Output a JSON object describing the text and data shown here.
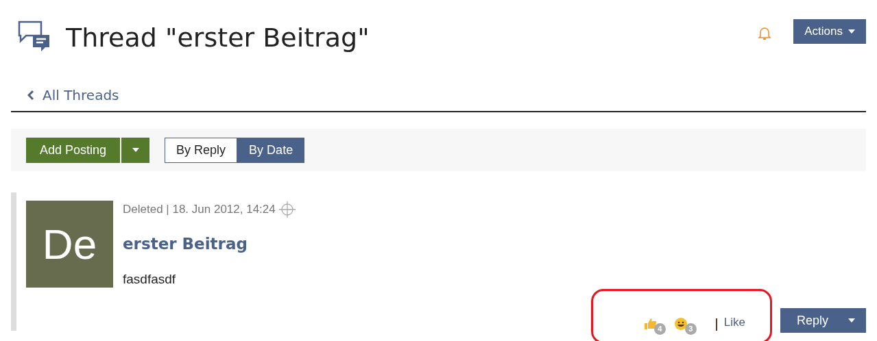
{
  "header": {
    "title": "Thread \"erster Beitrag\"",
    "actions_button": "Actions"
  },
  "back_link": "All Threads",
  "toolbar": {
    "add_button": "Add Posting",
    "sort_options": [
      {
        "label": "By Reply",
        "selected": false
      },
      {
        "label": "By Date",
        "selected": true
      }
    ]
  },
  "posting": {
    "avatar_initials": "De",
    "meta": "Deleted | 18. Jun 2012, 14:24",
    "title": "erster Beitrag",
    "body": "fasdfasdf",
    "reactions": [
      {
        "kind": "thumbs",
        "count": "4"
      },
      {
        "kind": "smile",
        "count": "3"
      }
    ],
    "like_link": "Like",
    "reply_button": "Reply",
    "highlighted": true
  }
}
